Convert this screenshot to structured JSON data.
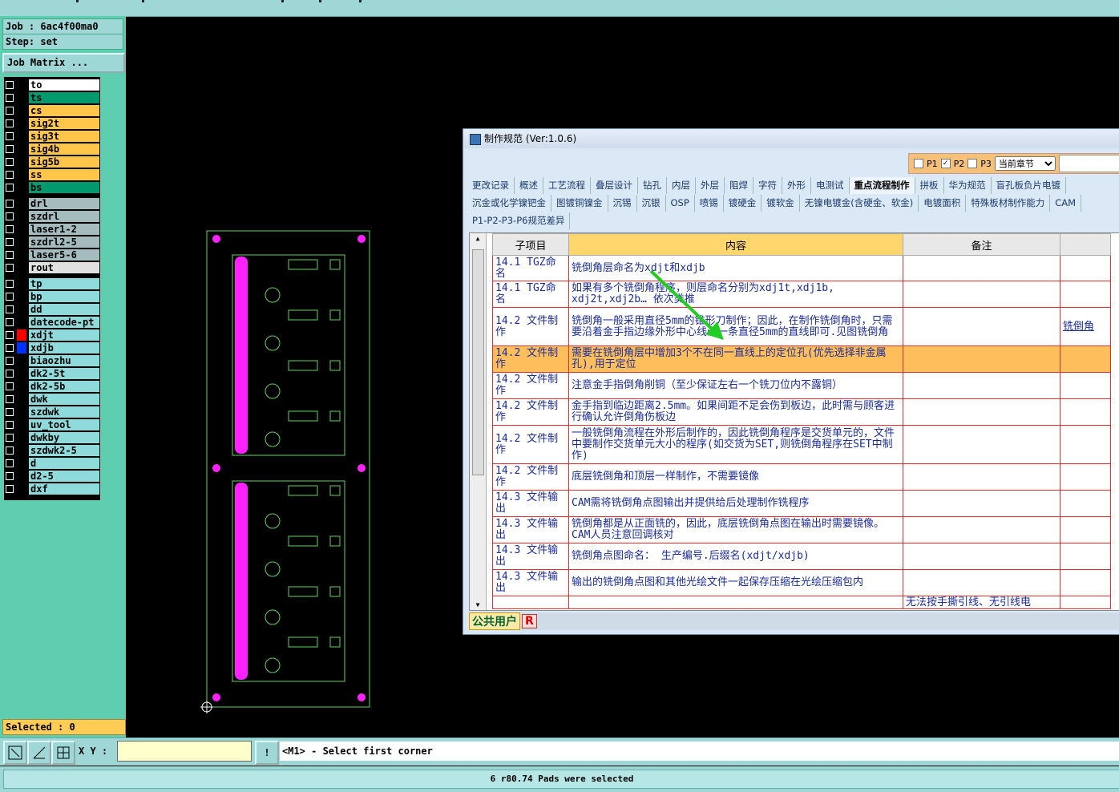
{
  "header": {
    "job_label": "Job : 6ac4f00ma0",
    "step_label": "Step: set",
    "job_matrix_button": "Job Matrix ..."
  },
  "layers": {
    "group1": [
      {
        "name": "to",
        "color": "#ffffff"
      },
      {
        "name": "ts",
        "color": "#009a6e"
      },
      {
        "name": "cs",
        "color": "#ffc64a"
      },
      {
        "name": "sig2t",
        "color": "#ffc64a"
      },
      {
        "name": "sig3t",
        "color": "#ffc64a"
      },
      {
        "name": "sig4b",
        "color": "#ffc64a"
      },
      {
        "name": "sig5b",
        "color": "#ffc64a"
      },
      {
        "name": "ss",
        "color": "#ffc64a"
      },
      {
        "name": "bs",
        "color": "#009a6e"
      }
    ],
    "group2": [
      {
        "name": "drl",
        "color": "#a5bcbf"
      },
      {
        "name": "szdrl",
        "color": "#a5bcbf"
      },
      {
        "name": "laser1-2",
        "color": "#a5bcbf"
      },
      {
        "name": "szdrl2-5",
        "color": "#a5bcbf"
      },
      {
        "name": "laser5-6",
        "color": "#a5bcbf"
      },
      {
        "name": "rout",
        "color": "#e0e0e0"
      }
    ],
    "group3": [
      {
        "name": "tp",
        "color": "#8fdada"
      },
      {
        "name": "bp",
        "color": "#8fdada"
      },
      {
        "name": "dd",
        "color": "#8fdada"
      },
      {
        "name": "datecode-pt",
        "color": "#8fdada"
      },
      {
        "name": "xdjt",
        "color": "#8fdada",
        "marker": "#ff0000"
      },
      {
        "name": "xdjb",
        "color": "#8fdada",
        "marker": "#0030ff"
      },
      {
        "name": "biaozhu",
        "color": "#8fdada"
      },
      {
        "name": "dk2-5t",
        "color": "#8fdada"
      },
      {
        "name": "dk2-5b",
        "color": "#8fdada"
      },
      {
        "name": "dwk",
        "color": "#8fdada"
      },
      {
        "name": "szdwk",
        "color": "#8fdada"
      },
      {
        "name": "uv_tool",
        "color": "#8fdada"
      },
      {
        "name": "dwkby",
        "color": "#8fdada"
      },
      {
        "name": "szdwk2-5",
        "color": "#8fdada"
      },
      {
        "name": "d",
        "color": "#8fdada"
      },
      {
        "name": "d2-5",
        "color": "#8fdada"
      },
      {
        "name": "dxf",
        "color": "#8fdada"
      }
    ]
  },
  "selected": "Selected : 0",
  "bottom": {
    "xy_label": "X Y :",
    "message": "<M1> - Select first corner",
    "status": "6 r80.74 Pads were selected"
  },
  "dialog": {
    "title": "制作规范 (Ver:1.0.6)",
    "options": {
      "p1": "P1",
      "p2": "P2",
      "p3": "P3",
      "section_select": "当前章节"
    },
    "tabs_row1": [
      "更改记录",
      "概述",
      "工艺流程",
      "叠层设计",
      "钻孔",
      "内层",
      "外层",
      "阻焊",
      "字符",
      "外形",
      "电测试",
      "重点流程制作",
      "拼板",
      "华为规范",
      "盲孔板负片电镀"
    ],
    "active_tab": "重点流程制作",
    "tabs_row2": [
      "沉金或化学镍钯金",
      "图镀铜镍金",
      "沉锡",
      "沉银",
      "OSP",
      "喷锡",
      "镀硬金",
      "镀软金",
      "无镍电镀金(含硬金、软金)",
      "电镀面积",
      "特殊板材制作能力",
      "CAM"
    ],
    "tabs_row3": [
      "P1-P2-P3-P6规范差异"
    ],
    "columns": [
      "子项目",
      "内容",
      "备注"
    ],
    "rows": [
      {
        "item": "14.1 TGZ命名",
        "content": "铣倒角层命名为xdjt和xdjb",
        "note": "",
        "extra": ""
      },
      {
        "item": "14.1 TGZ命名",
        "content": "如果有多个铣倒角程序，则层命名分别为xdj1t,xdj1b, xdj2t,xdj2b… 依次类推",
        "note": "",
        "extra": ""
      },
      {
        "item": "14.2 文件制作",
        "content": "铣倒角一般采用直径5mm的锥形刀制作；因此，在制作铣倒角时，只需要沿着金手指边缘外形中心线画一条直径5mm的直线即可.见图铣倒角",
        "note": "",
        "extra": "铣倒角"
      },
      {
        "item": "14.2 文件制作",
        "content": "需要在铣倒角层中增加3个不在同一直线上的定位孔(优先选择非金属孔),用于定位",
        "note": "",
        "extra": "",
        "highlight": true
      },
      {
        "item": "14.2 文件制作",
        "content": "注意金手指倒角削铜（至少保证左右一个铣刀位内不露铜）",
        "note": "",
        "extra": ""
      },
      {
        "item": "14.2 文件制作",
        "content": "金手指到临边距离2.5mm。如果间距不足会伤到板边，此时需与顾客进行确认允许倒角伤板边",
        "note": "",
        "extra": ""
      },
      {
        "item": "14.2 文件制作",
        "content": "一般铣倒角流程在外形后制作的，因此铣倒角程序是交货单元的，文件中要制作交货单元大小的程序(如交货为SET,则铣倒角程序在SET中制作)",
        "note": "",
        "extra": ""
      },
      {
        "item": "14.2 文件制作",
        "content": "底层铣倒角和顶层一样制作，不需要镜像",
        "note": "",
        "extra": ""
      },
      {
        "item": "14.3 文件输出",
        "content": "CAM需将铣倒角点图输出并提供给后处理制作铣程序",
        "note": "",
        "extra": ""
      },
      {
        "item": "14.3 文件输出",
        "content": "铣倒角都是从正面铣的，因此，底层铣倒角点图在输出时需要镜像。CAM人员注意回调核对",
        "note": "",
        "extra": ""
      },
      {
        "item": "14.3 文件输出",
        "content": "铣倒角点图命名： 生产编号.后缀名(xdjt/xdjb)",
        "note": "",
        "extra": ""
      },
      {
        "item": "14.3 文件输出",
        "content": "输出的铣倒角点图和其他光绘文件一起保存压缩在光绘压缩包内",
        "note": "",
        "extra": ""
      },
      {
        "item": "",
        "content": "",
        "note": "无法按手撕引线、无引线电",
        "extra": ""
      }
    ],
    "footer_user": "公共用户",
    "footer_r": "R"
  },
  "colors": {
    "board_outline": "#5fd35f",
    "pad": "#ff22ff",
    "arrow": "#22cc22"
  }
}
